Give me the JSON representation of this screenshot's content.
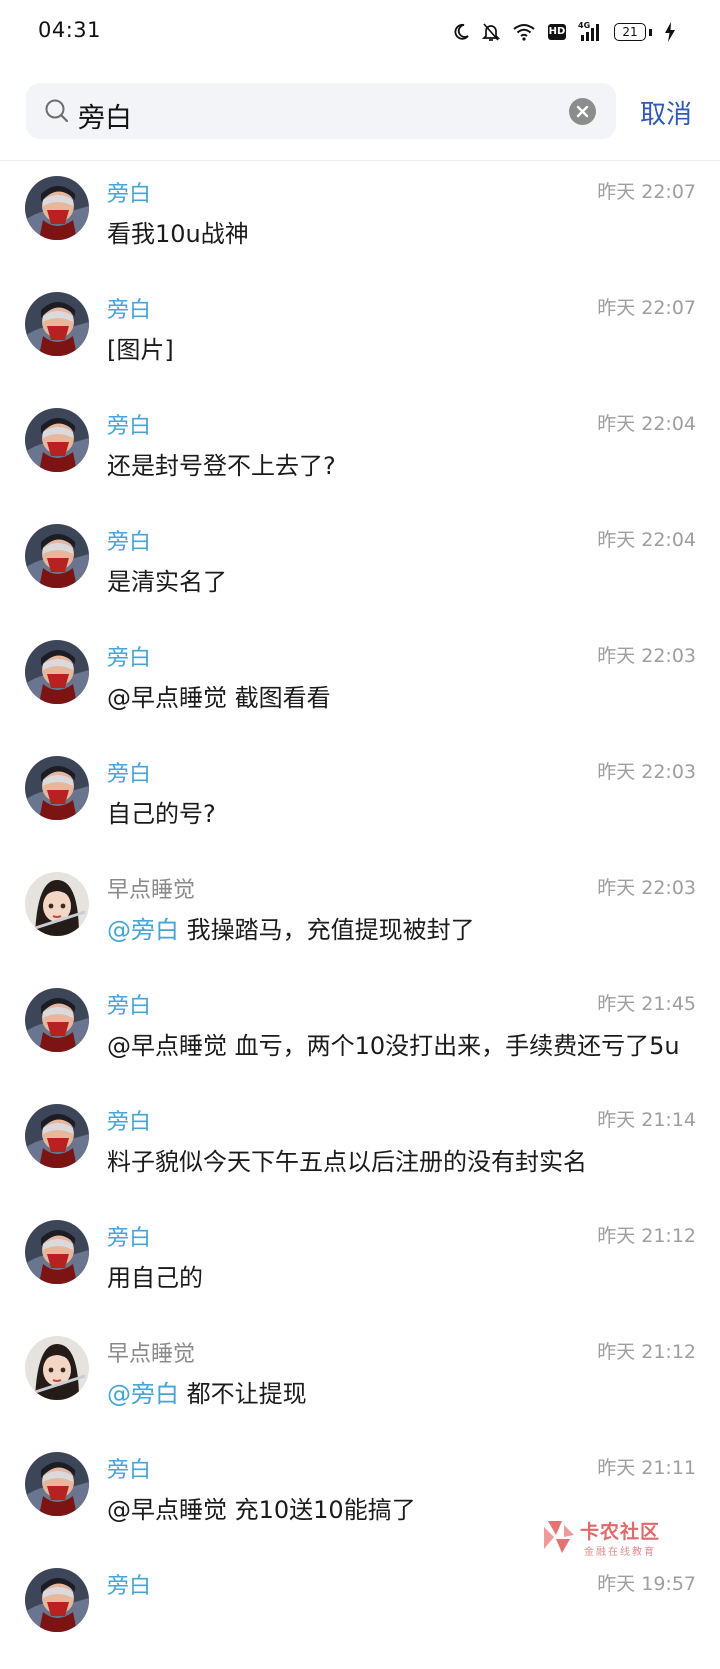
{
  "status_bar": {
    "time": "04:31",
    "icons": [
      "moon-icon",
      "bell-off-icon",
      "wifi-icon",
      "hd-icon",
      "signal-4g-icon",
      "battery-icon",
      "charging-icon"
    ],
    "hd_label": "HD",
    "network_label": "4G",
    "battery": "21"
  },
  "search": {
    "query": "旁白",
    "cancel_label": "取消"
  },
  "messages": [
    {
      "sender": "旁白",
      "time": "昨天 22:07",
      "text": "看我10u战神"
    },
    {
      "sender": "旁白",
      "time": "昨天 22:07",
      "text": "[图片]"
    },
    {
      "sender": "旁白",
      "time": "昨天 22:04",
      "text": "还是封号登不上去了?"
    },
    {
      "sender": "旁白",
      "time": "昨天 22:04",
      "text": "是清实名了"
    },
    {
      "sender": "旁白",
      "time": "昨天 22:03",
      "text": "@早点睡觉 截图看看"
    },
    {
      "sender": "旁白",
      "time": "昨天 22:03",
      "text": "自己的号?"
    },
    {
      "sender": "早点睡觉",
      "time": "昨天 22:03",
      "mention": "@旁白",
      "text": " 我操踏马，充值提现被封了"
    },
    {
      "sender": "旁白",
      "time": "昨天 21:45",
      "text": "@早点睡觉 血亏，两个10没打出来，手续费还亏了5u"
    },
    {
      "sender": "旁白",
      "time": "昨天 21:14",
      "text": "料子貌似今天下午五点以后注册的没有封实名"
    },
    {
      "sender": "旁白",
      "time": "昨天 21:12",
      "text": "用自己的"
    },
    {
      "sender": "早点睡觉",
      "time": "昨天 21:12",
      "mention": "@旁白",
      "text": " 都不让提现"
    },
    {
      "sender": "旁白",
      "time": "昨天 21:11",
      "text": "@早点睡觉 充10送10能搞了"
    },
    {
      "sender": "旁白",
      "time": "昨天 19:57",
      "text": ""
    }
  ],
  "watermark": {
    "title": "卡农社区",
    "subtitle": "金融在线教育"
  },
  "colors": {
    "sender_highlight": "#46a5d6",
    "sender_other": "#8a8a8a",
    "cancel": "#2f58b8",
    "search_bg": "#f2f4f8"
  }
}
